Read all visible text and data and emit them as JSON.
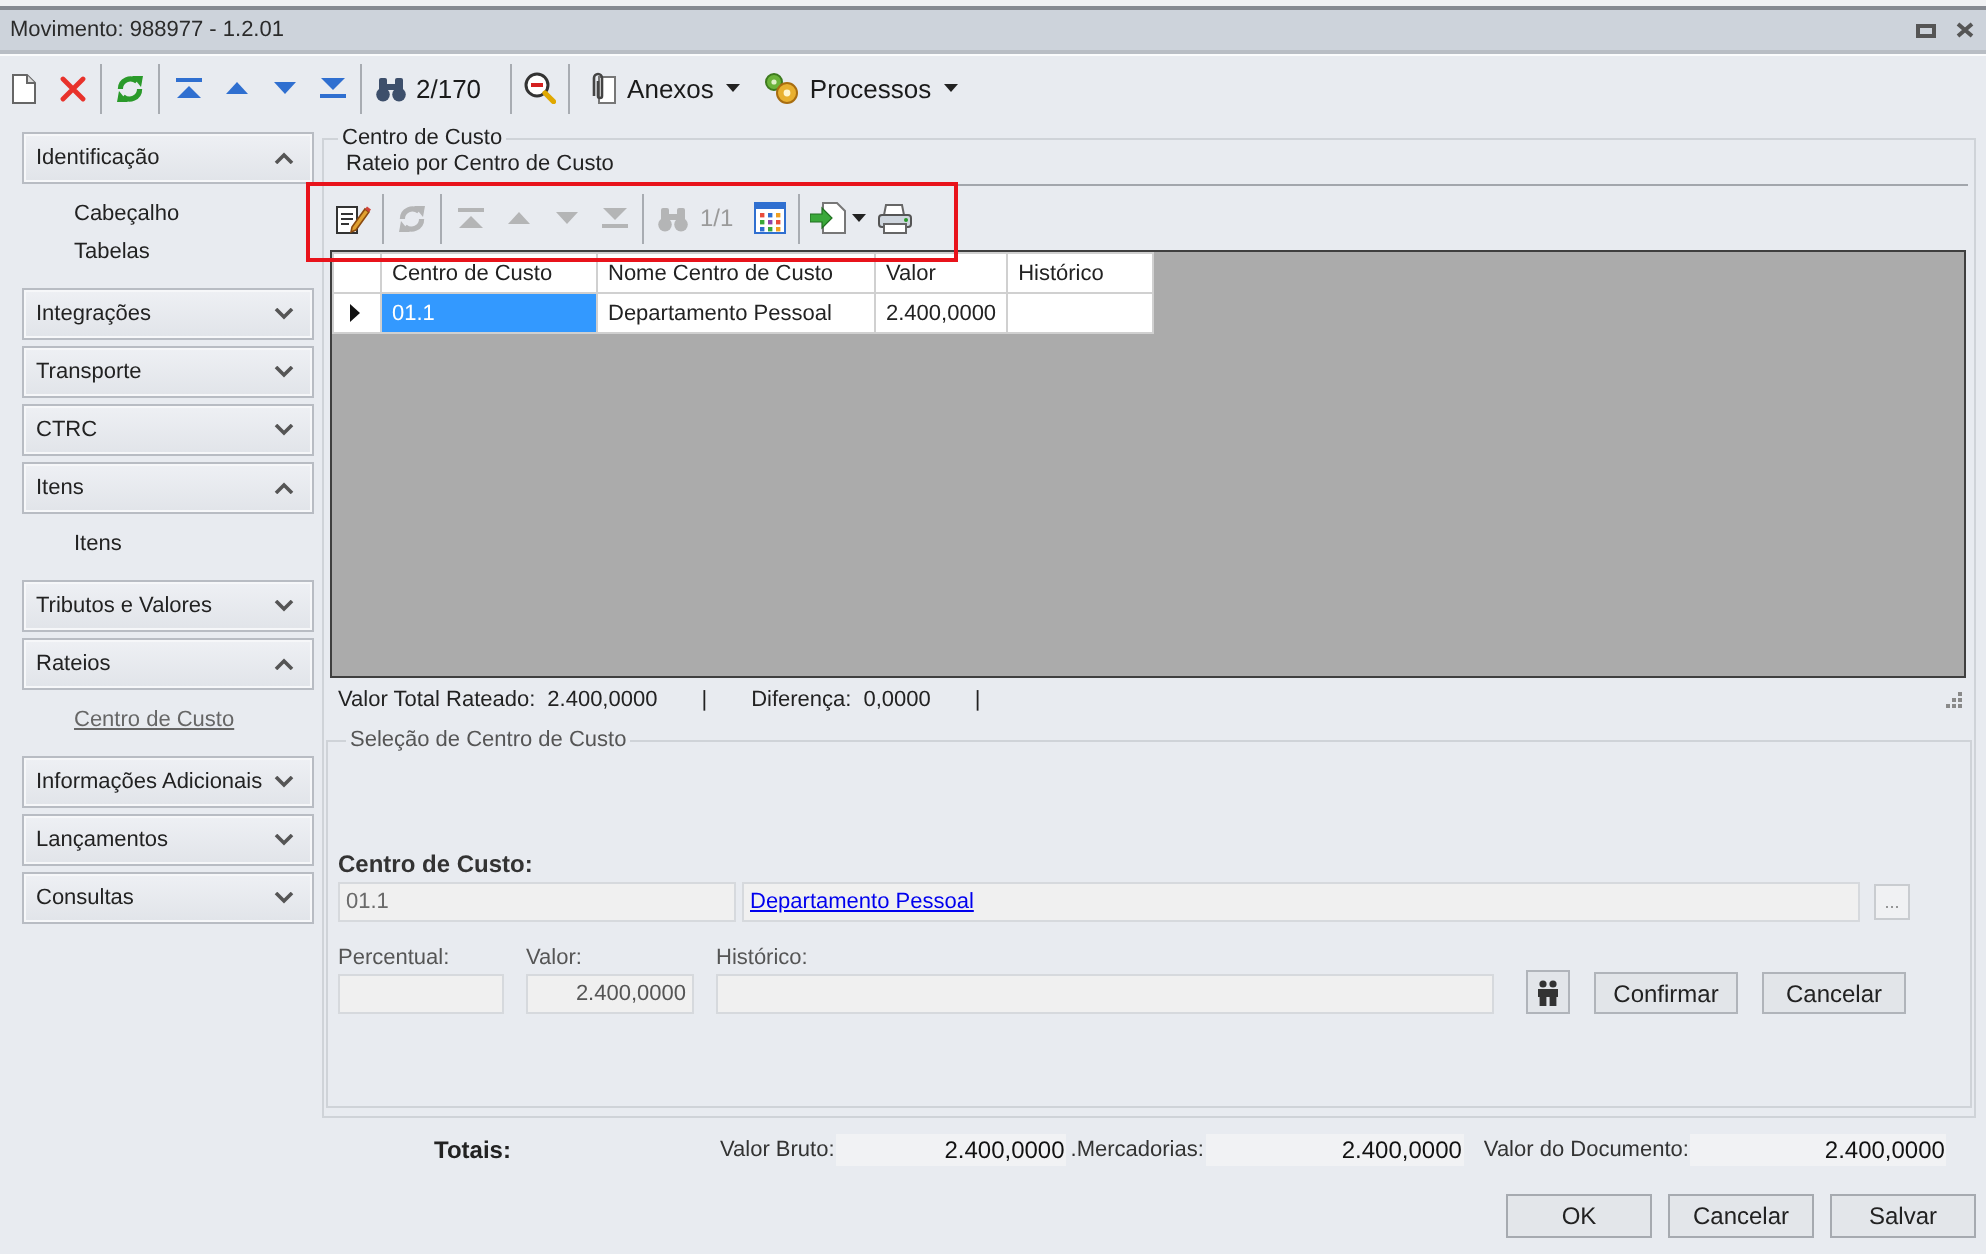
{
  "window": {
    "title": "Movimento: 988977 - 1.2.01"
  },
  "toolbar": [
    {
      "kind": "new"
    },
    {
      "kind": "delete"
    },
    {
      "kind": "separator"
    },
    {
      "kind": "refresh"
    },
    {
      "kind": "separator"
    },
    {
      "kind": "first"
    },
    {
      "kind": "previous"
    },
    {
      "kind": "next"
    },
    {
      "kind": "last"
    },
    {
      "kind": "separator"
    },
    {
      "kind": "find"
    },
    {
      "kind": "counter",
      "label": "2/170"
    },
    {
      "kind": "separator"
    },
    {
      "kind": "query"
    },
    {
      "kind": "separator"
    },
    {
      "kind": "attachments",
      "label": "Anexos"
    },
    {
      "kind": "processes",
      "label": "Processos"
    }
  ],
  "sidebar": [
    {
      "label": "Identificação",
      "expanded": true,
      "children": [
        {
          "label": "Cabeçalho",
          "selected": false
        },
        {
          "label": "Tabelas",
          "selected": false
        }
      ]
    },
    {
      "label": "Integrações",
      "expanded": false
    },
    {
      "label": "Transporte",
      "expanded": false
    },
    {
      "label": "CTRC",
      "expanded": false
    },
    {
      "label": "Itens",
      "expanded": true,
      "children": [
        {
          "label": "Itens",
          "selected": false
        }
      ]
    },
    {
      "label": "Tributos e Valores",
      "expanded": false
    },
    {
      "label": "Rateios",
      "expanded": true,
      "children": [
        {
          "label": "Centro de Custo",
          "selected": true
        }
      ]
    },
    {
      "label": "Informações Adicionais",
      "expanded": false
    },
    {
      "label": "Lançamentos",
      "expanded": false
    },
    {
      "label": "Consultas",
      "expanded": false
    }
  ],
  "panel": {
    "title": "Centro de Custo",
    "subtitle": "Rateio por Centro de Custo",
    "grid_toolbar": [
      {
        "kind": "edit",
        "disabled": false
      },
      {
        "kind": "separator"
      },
      {
        "kind": "refresh",
        "disabled": true
      },
      {
        "kind": "separator"
      },
      {
        "kind": "first",
        "disabled": true
      },
      {
        "kind": "previous",
        "disabled": true
      },
      {
        "kind": "next",
        "disabled": true
      },
      {
        "kind": "last",
        "disabled": true
      },
      {
        "kind": "separator"
      },
      {
        "kind": "find",
        "disabled": true
      },
      {
        "kind": "counter",
        "label": "1/1",
        "disabled": true
      },
      {
        "kind": "columns",
        "disabled": false
      },
      {
        "kind": "separator"
      },
      {
        "kind": "export",
        "disabled": false
      },
      {
        "kind": "print",
        "disabled": false
      }
    ],
    "table": {
      "columns": [
        "Centro de Custo",
        "Nome Centro de Custo",
        "Valor",
        "Histórico"
      ],
      "rows": [
        {
          "selected": true,
          "cells": [
            "01.1",
            "Departamento Pessoal",
            "2.400,0000"
          ]
        }
      ]
    },
    "summary": [
      {
        "label": "Valor Total Rateado:",
        "value": "2.400,0000",
        "separator": "|"
      },
      {
        "label": "Diferença:",
        "value": "0,0000",
        "separator": "|"
      }
    ]
  },
  "selection": {
    "title": "Seleção de Centro de Custo",
    "cost_center": {
      "label": "Centro de Custo:",
      "code": "01.1",
      "name": "Departamento Pessoal",
      "browse_button": "..."
    },
    "fields": [
      {
        "label": "Percentual:"
      },
      {
        "label": "Valor:",
        "value": "2.400,0000"
      },
      {
        "label": "Histórico:"
      }
    ],
    "buttons": [
      "Confirmar",
      "Cancelar"
    ]
  },
  "totals": {
    "label": "Totais:",
    "items": [
      {
        "label": "Valor Bruto:",
        "value": "2.400,0000"
      },
      {
        "label": ".Mercadorias:",
        "value": "2.400,0000"
      },
      {
        "label": "Valor do Documento:",
        "value": "2.400,0000"
      }
    ]
  },
  "buttons": [
    "OK",
    "Cancelar",
    "Salvar"
  ]
}
